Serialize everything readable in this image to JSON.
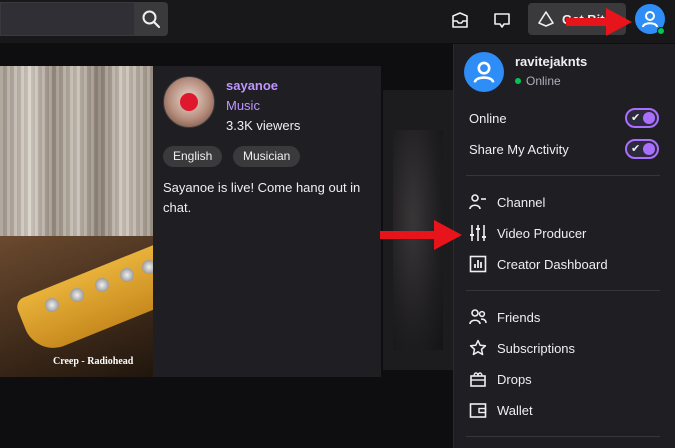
{
  "topbar": {
    "search_icon": "search-icon",
    "inbox_icon": "inbox-icon",
    "whispers_icon": "whispers-icon",
    "get_bits_label": "Get Bits",
    "avatar_icon": "user-icon"
  },
  "hover_card": {
    "thumbnail_caption": "Creep - Radiohead",
    "streamer_name": "sayanoe",
    "category": "Music",
    "viewers": "3.3K viewers",
    "tags": [
      "English",
      "Musician"
    ],
    "description": "Sayanoe is live! Come hang out in chat."
  },
  "menu": {
    "username": "ravitejaknts",
    "status": "Online",
    "toggles": [
      {
        "label": "Online",
        "on": true
      },
      {
        "label": "Share My Activity",
        "on": true
      }
    ],
    "section1": [
      {
        "label": "Channel",
        "icon": "channel-icon"
      },
      {
        "label": "Video Producer",
        "icon": "sliders-icon"
      },
      {
        "label": "Creator Dashboard",
        "icon": "dashboard-icon"
      }
    ],
    "section2": [
      {
        "label": "Friends",
        "icon": "friends-icon"
      },
      {
        "label": "Subscriptions",
        "icon": "star-icon"
      },
      {
        "label": "Drops",
        "icon": "drops-icon"
      },
      {
        "label": "Wallet",
        "icon": "wallet-icon"
      }
    ]
  },
  "colors": {
    "accent": "#a970ff",
    "link": "#bf94ff",
    "annotation_arrow": "#e8141c",
    "avatar": "#2f8df7",
    "online": "#00c853"
  }
}
